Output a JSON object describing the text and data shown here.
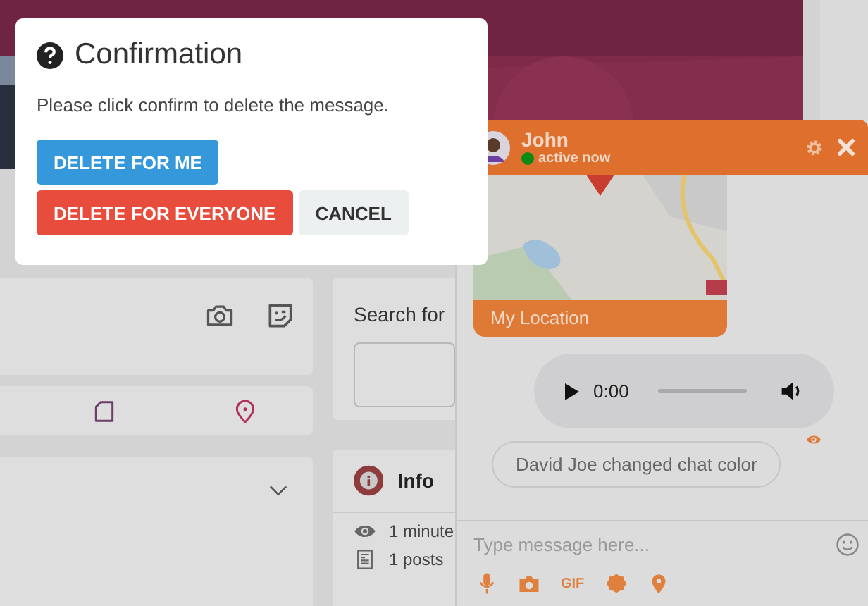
{
  "dialog": {
    "title": "Confirmation",
    "message": "Please click confirm to delete the message.",
    "buttons": [
      {
        "label": "DELETE FOR ME",
        "kind": "primary"
      },
      {
        "label": "DELETE FOR EVERYONE",
        "kind": "danger"
      },
      {
        "label": "CANCEL",
        "kind": "default"
      }
    ]
  },
  "search_card": {
    "label": "Search for"
  },
  "info_card": {
    "title": "Info",
    "stats": [
      {
        "kind": "views",
        "text": "1 minute"
      },
      {
        "kind": "posts",
        "text": "1 posts"
      }
    ]
  },
  "chat": {
    "name": "John",
    "status": "active now",
    "online": true,
    "messages": [
      {
        "kind": "location",
        "label": "My Location"
      },
      {
        "kind": "audio",
        "time": "0:00"
      },
      {
        "kind": "notice",
        "text": "David Joe changed chat color",
        "seen": true
      }
    ],
    "input": {
      "placeholder": "Type message here..."
    },
    "toolbar": {
      "gif_label": "GIF"
    }
  }
}
